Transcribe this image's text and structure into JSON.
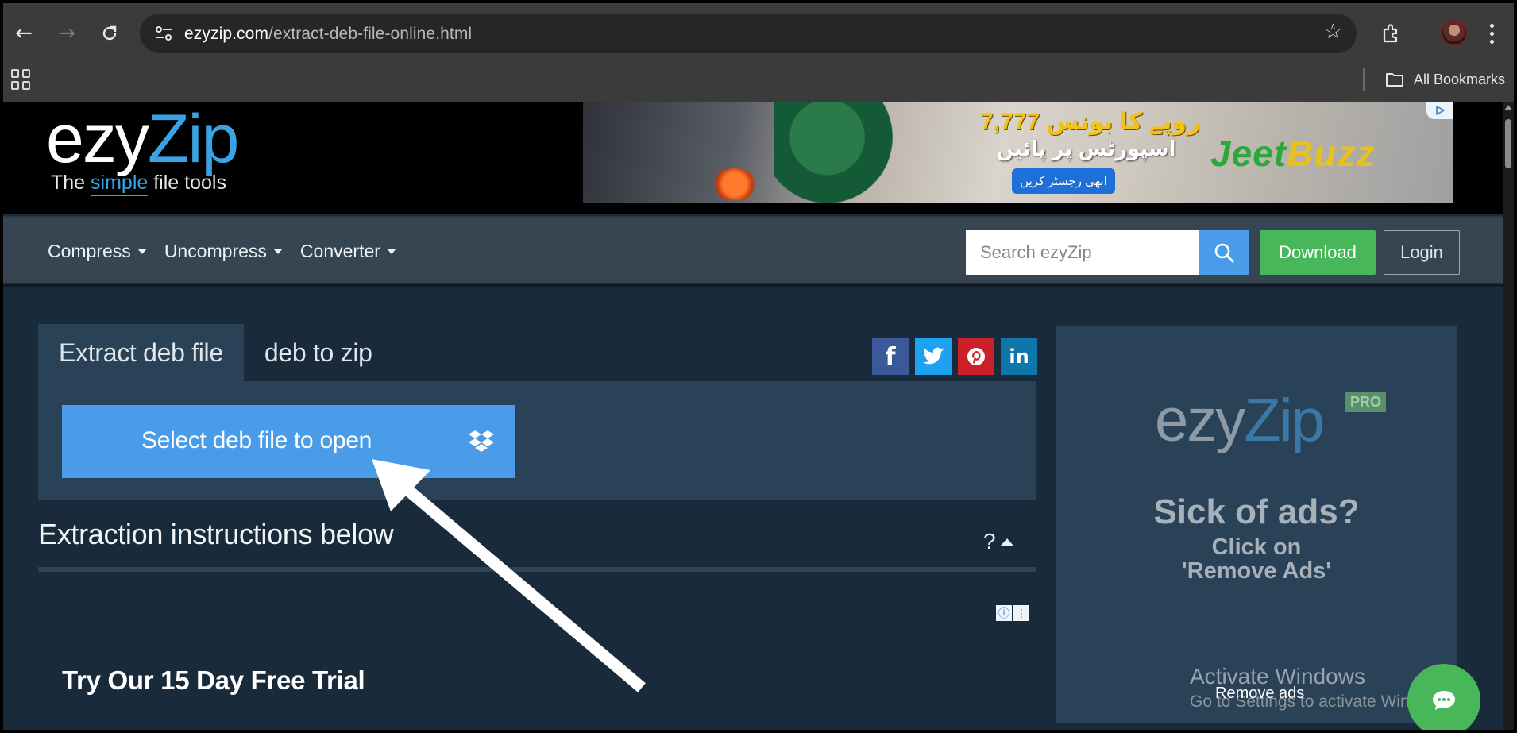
{
  "browser": {
    "url_host": "ezyzip.com",
    "url_path": "/extract-deb-file-online.html",
    "bookmarks_label": "All Bookmarks"
  },
  "header": {
    "logo_ezy": "ezy",
    "logo_zip": "Zip",
    "tagline_before": "The ",
    "tagline_simple": "simple",
    "tagline_after": " file tools"
  },
  "ad_banner": {
    "amount": "7,777 روپے کا بونس",
    "line2": "اسپورٹس پر پائیں",
    "cta": "ابھی رجسٹر کریں",
    "brand_jeet": "Jeet",
    "brand_buzz": "Buzz"
  },
  "nav": {
    "items": [
      {
        "label": "Compress"
      },
      {
        "label": "Uncompress"
      },
      {
        "label": "Converter"
      }
    ],
    "search_placeholder": "Search ezyZip",
    "download_label": "Download",
    "login_label": "Login"
  },
  "main": {
    "tabs": [
      {
        "label": "Extract deb file",
        "active": true
      },
      {
        "label": "deb to zip",
        "active": false
      }
    ],
    "social": [
      "facebook",
      "twitter",
      "pinterest",
      "linkedin"
    ],
    "select_button_label": "Select deb file to open",
    "instructions_heading": "Extraction instructions below",
    "help_label": "?",
    "trial_heading": "Try Our 15 Day Free Trial"
  },
  "side_ad": {
    "logo_ezy": "ezy",
    "logo_zip": "Zip",
    "pro_badge": "PRO",
    "sick_text": "Sick of ads?",
    "click_line1": "Click on",
    "click_line2": "'Remove Ads'",
    "remove_ads": "Remove ads"
  },
  "os_watermark": {
    "title": "Activate Windows",
    "subtitle": "Go to Settings to activate Windows."
  },
  "colors": {
    "accent_blue": "#4a9be8",
    "download_green": "#48b75a",
    "page_bg": "#192b3b",
    "panel_bg": "#2a4257"
  }
}
